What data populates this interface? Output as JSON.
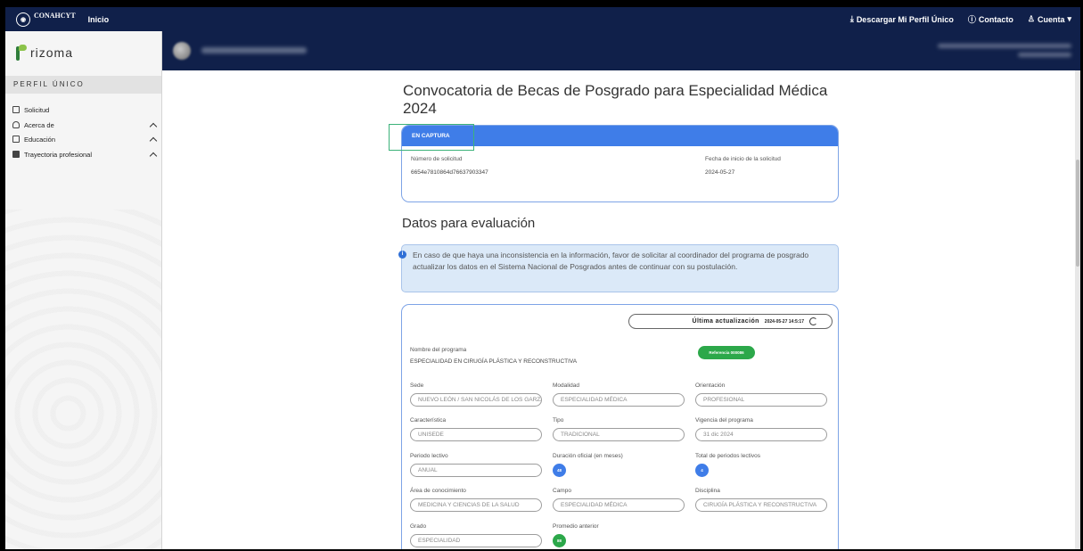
{
  "topbar": {
    "gov_name": "CONAHCYT",
    "inicio": "Inicio",
    "descargar": "Descargar Mi Perfil Único",
    "contacto": "Contacto",
    "cuenta": "Cuenta"
  },
  "sidebar": {
    "brand": "rizoma",
    "section_title": "PERFIL ÚNICO",
    "items": [
      {
        "label": "Solicitud"
      },
      {
        "label": "Acerca de"
      },
      {
        "label": "Educación"
      },
      {
        "label": "Trayectoria profesional"
      }
    ]
  },
  "main": {
    "title": "Convocatoria de Becas de Posgrado para Especialidad Médica 2024",
    "status": "EN CAPTURA",
    "numero_label": "Número de solicitud",
    "numero_value": "6654e7810864d76637903347",
    "fecha_label": "Fecha de inicio de la solicitud",
    "fecha_value": "2024-05-27",
    "section_title": "Datos para evaluación",
    "alert_text": "En caso de que haya una inconsistencia en la información, favor de solicitar al coordinador del programa de posgrado actualizar los datos en el Sistema Nacional de Posgrados antes de continuar con su postulación.",
    "update_label": "Última actualización",
    "update_value": "2024-05-27 14:5:17",
    "programa_label": "Nombre del programa",
    "programa_value": "ESPECIALIDAD EN CIRUGÍA PLÁSTICA Y RECONSTRUCTIVA",
    "referencia": "Referencia 000086",
    "fields": {
      "sede": {
        "label": "Sede",
        "value": "NUEVO LEÓN / SAN NICOLÁS DE LOS GARZA"
      },
      "modalidad": {
        "label": "Modalidad",
        "value": "ESPECIALIDAD MÉDICA"
      },
      "orientacion": {
        "label": "Orientación",
        "value": "PROFESIONAL"
      },
      "caracteristica": {
        "label": "Característica",
        "value": "UNISEDE"
      },
      "tipo": {
        "label": "Tipo",
        "value": "TRADICIONAL"
      },
      "vigencia": {
        "label": "Vigencia del programa",
        "value": "31 dic 2024"
      },
      "periodo": {
        "label": "Periodo lectivo",
        "value": "ANUAL"
      },
      "duracion": {
        "label": "Duración oficial (en meses)",
        "value": "48"
      },
      "total_periodos": {
        "label": "Total de periodos lectivos",
        "value": "4"
      },
      "area": {
        "label": "Área de conocimiento",
        "value": "MEDICINA Y CIENCIAS DE LA SALUD"
      },
      "campo": {
        "label": "Campo",
        "value": "ESPECIALIDAD MÉDICA"
      },
      "disciplina": {
        "label": "Disciplina",
        "value": "CIRUGÍA PLÁSTICA Y RECONSTRUCTIVA"
      },
      "grado": {
        "label": "Grado",
        "value": "ESPECIALIDAD"
      },
      "promedio": {
        "label": "Promedio anterior",
        "value": "88"
      }
    }
  }
}
